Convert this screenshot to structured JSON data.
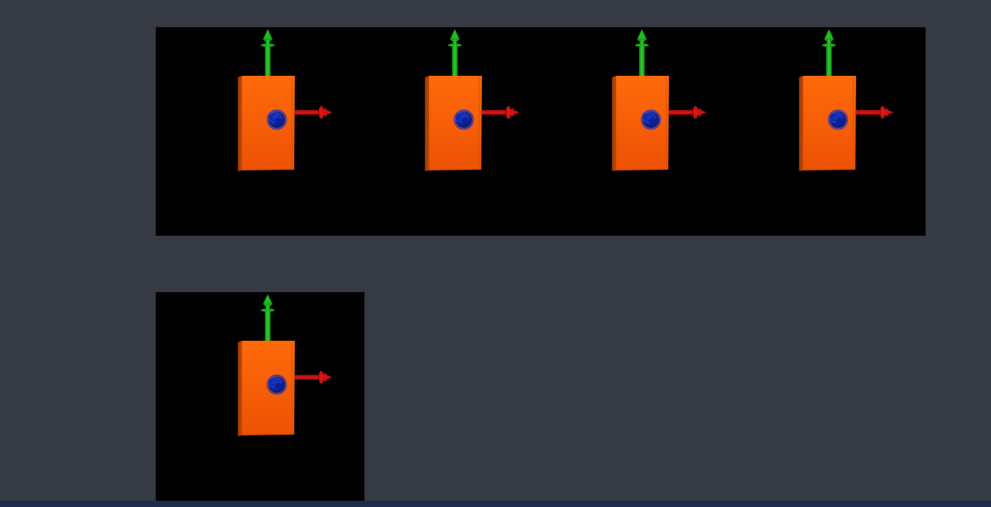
{
  "colors": {
    "page_background": "#363a42",
    "viewport_background": "#000000",
    "box_light": "#ff6a0a",
    "box_dark": "#c44706",
    "y_axis": "#1fbf1f",
    "x_axis": "#d81414",
    "z_axis": "#0a1f9e",
    "status_bar": "#1d2c4c"
  },
  "viewports": [
    {
      "id": "render-1",
      "icon": "box-with-axes"
    },
    {
      "id": "render-2",
      "icon": "box-with-axes"
    },
    {
      "id": "render-3",
      "icon": "box-with-axes"
    },
    {
      "id": "render-4",
      "icon": "box-with-axes"
    },
    {
      "id": "render-5",
      "icon": "box-with-axes"
    }
  ]
}
